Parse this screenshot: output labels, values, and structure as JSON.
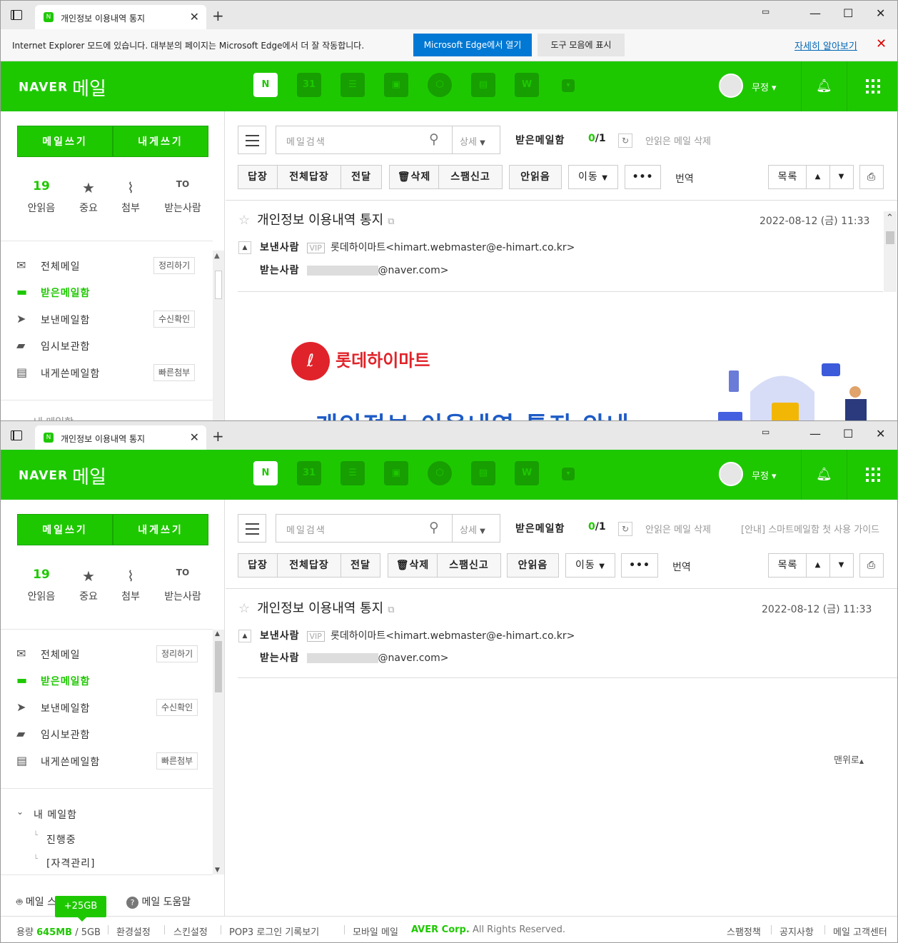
{
  "browser": {
    "tab_title": "개인정보 이용내역 통지",
    "tab_favicon": "N",
    "new_tab": "+",
    "close_tab": "✕",
    "ie_message": "Internet Explorer 모드에 있습니다. 대부분의 페이지는 Microsoft Edge에서 더 잘 작동합니다.",
    "open_edge": "Microsoft Edge에서 열기",
    "show_toolbar": "도구 모음에 표시",
    "learn_more": "자세히 알아보기",
    "minimize": "—",
    "maximize": "☐",
    "close": "✕"
  },
  "header": {
    "logo_naver": "NAVER",
    "logo_mail": "메일",
    "user_name": "무정",
    "apps": [
      "N",
      "31",
      "☰",
      "▣",
      "⬡",
      "▤",
      "W",
      "▾"
    ]
  },
  "sidebar": {
    "compose": "메일쓰기",
    "write_to_me": "내게쓰기",
    "quick": [
      {
        "value": "19",
        "icon": "",
        "label": "안읽음"
      },
      {
        "value": "",
        "icon": "★",
        "label": "중요"
      },
      {
        "value": "",
        "icon": "⌇",
        "label": "첨부"
      },
      {
        "value": "",
        "icon": "TO",
        "label": "받는사람"
      }
    ],
    "folders": [
      {
        "icon": "✉",
        "label": "전체메일",
        "action": "정리하기"
      },
      {
        "icon": "▬",
        "label": "받은메일함",
        "action": ""
      },
      {
        "icon": "➤",
        "label": "보낸메일함",
        "action": "수신확인"
      },
      {
        "icon": "▰",
        "label": "임시보관함",
        "action": ""
      },
      {
        "icon": "▤",
        "label": "내게쓴메일함",
        "action": "빠른첨부"
      }
    ],
    "my_mailbox": "내 메일함",
    "my_mailbox_cut": "내 메일함",
    "sub_folders": [
      "진행중",
      "[자격관리]"
    ],
    "smartbot": "메일 스마트봇",
    "help": "메일 도움말"
  },
  "toolbar": {
    "search_placeholder": "메일검색",
    "search_option": "상세",
    "mailbox": "받은메일함",
    "count_unread": "0",
    "count_total": "/1",
    "delete_unread": "안읽은 메일 삭제",
    "guide": "[안내] 스마트메일함 첫 사용 가이드",
    "reply": "답장",
    "reply_all": "전체답장",
    "forward": "전달",
    "delete": "삭제",
    "spam": "스팸신고",
    "mark_unread": "안읽음",
    "move": "이동",
    "more": "•••",
    "translate": "번역",
    "list": "목록"
  },
  "message": {
    "subject": "개인정보 이용내역 통지",
    "date": "2022-08-12 (금) 11:33",
    "from_label": "보낸사람",
    "vip": "VIP",
    "from": "롯데하이마트<himart.webmaster@e-himart.co.kr>",
    "to_label": "받는사람",
    "to_suffix": "@naver.com>",
    "brand": "롯데하이마트",
    "banner_title": "개인정보 이용내역 통지 안내",
    "top_link": "맨위로"
  },
  "footer": {
    "usage_label": "용량",
    "usage_used": "645MB",
    "usage_total": "/ 5GB",
    "bonus": "+25GB",
    "settings": "환경설정",
    "skin": "스킨설정",
    "pop3": "POP3 로그인 기록보기",
    "mobile": "모바일 메일",
    "copyright_brand": "AVER Corp.",
    "copyright": "All Rights Reserved.",
    "spam_policy": "스팸정책",
    "notice": "공지사항",
    "support": "메일 고객센터"
  },
  "colors": {
    "naver_green": "#1ec800",
    "edge_blue": "#0078d4",
    "lotte_red": "#e0232a"
  }
}
